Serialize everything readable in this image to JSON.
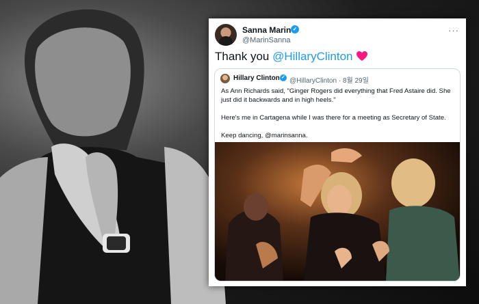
{
  "tweet": {
    "author_name": "Sanna Marin",
    "author_handle": "@MarinSanna",
    "more_label": "···",
    "verified_mark": "✓",
    "text_prefix": "Thank you ",
    "text_mention": "@HillaryClinton",
    "heart_icon": "heart-icon"
  },
  "quoted": {
    "author_name": "Hillary Clinton",
    "verified_mark": "✓",
    "meta": "@HillaryClinton · 8월 29일",
    "paragraph1": "As Ann Richards said, \"Ginger Rogers did everything that Fred Astaire did. She just did it backwards and in high heels.\"",
    "paragraph2": "Here's me in Cartagena while I was there for a meeting as Secretary of State.",
    "paragraph3": "Keep dancing, @marinsanna."
  },
  "colors": {
    "accent": "#1d9bf0",
    "heart": "#f91880",
    "text_primary": "#0f1419",
    "text_secondary": "#536471"
  }
}
